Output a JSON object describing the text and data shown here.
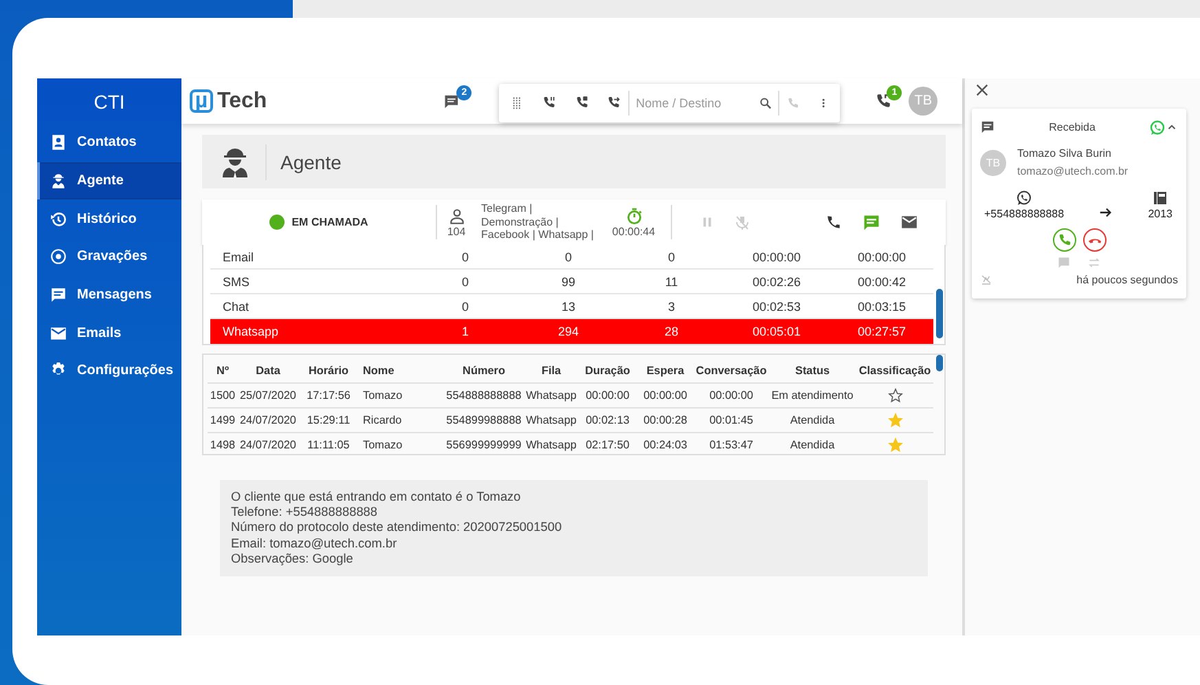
{
  "sidebar": {
    "title": "CTI",
    "items": [
      {
        "label": "Contatos",
        "selected": false
      },
      {
        "label": "Agente",
        "selected": true
      },
      {
        "label": "Histórico",
        "selected": false
      },
      {
        "label": "Gravações",
        "selected": false
      },
      {
        "label": "Mensagens",
        "selected": false
      },
      {
        "label": "Emails",
        "selected": false
      },
      {
        "label": "Configurações",
        "selected": false
      }
    ]
  },
  "header": {
    "logo_mark": "µ",
    "logo_text": "Tech",
    "messages_badge": "2",
    "search": {
      "placeholder": "Nome / Destino"
    },
    "calls_badge": "1",
    "avatar": "TB"
  },
  "page_title": "Agente",
  "status_bar": {
    "status": "EM CHAMADA",
    "extension": "104",
    "queues": [
      "Telegram |",
      "Demonstração |",
      "Facebook | Whatsapp |"
    ],
    "timer": "00:00:44"
  },
  "channels": {
    "rows": [
      {
        "cells": [
          "Email",
          "0",
          "0",
          "0",
          "00:00:00",
          "00:00:00"
        ],
        "selected": false
      },
      {
        "cells": [
          "SMS",
          "0",
          "99",
          "11",
          "00:02:26",
          "00:00:42"
        ],
        "selected": false
      },
      {
        "cells": [
          "Chat",
          "0",
          "13",
          "3",
          "00:02:53",
          "00:03:15"
        ],
        "selected": false
      },
      {
        "cells": [
          "Whatsapp",
          "1",
          "294",
          "28",
          "00:05:01",
          "00:27:57"
        ],
        "selected": true
      }
    ]
  },
  "history": {
    "columns": [
      "Nº",
      "Data",
      "Horário",
      "Nome",
      "Número",
      "Fila",
      "Duração",
      "Espera",
      "Conversação",
      "Status",
      "Classificação"
    ],
    "rows": [
      {
        "cells": [
          "1500",
          "25/07/2020",
          "17:17:56",
          "Tomazo",
          "554888888888",
          "Whatsapp",
          "00:00:00",
          "00:00:00",
          "00:00:00",
          "Em atendimento"
        ],
        "rated": false
      },
      {
        "cells": [
          "1499",
          "24/07/2020",
          "15:29:11",
          "Ricardo",
          "554899988888",
          "Whatsapp",
          "00:02:13",
          "00:00:28",
          "00:01:45",
          "Atendida"
        ],
        "rated": true
      },
      {
        "cells": [
          "1498",
          "24/07/2020",
          "11:11:05",
          "Tomazo",
          "556999999999",
          "Whatsapp",
          "02:17:50",
          "00:24:03",
          "01:53:47",
          "Atendida"
        ],
        "rated": true
      }
    ]
  },
  "info": [
    "O cliente que está entrando em contato é o Tomazo",
    "Telefone: +554888888888",
    "Número do protocolo deste atendimento: 20200725001500",
    "Email: tomazo@utech.com.br",
    "Observações: Google"
  ],
  "call_card": {
    "direction": "Recebida",
    "avatar": "TB",
    "name": "Tomazo Silva Burin",
    "email": "tomazo@utech.com.br",
    "from": "+554888888888",
    "to": "2013",
    "time": "há poucos segundos"
  }
}
